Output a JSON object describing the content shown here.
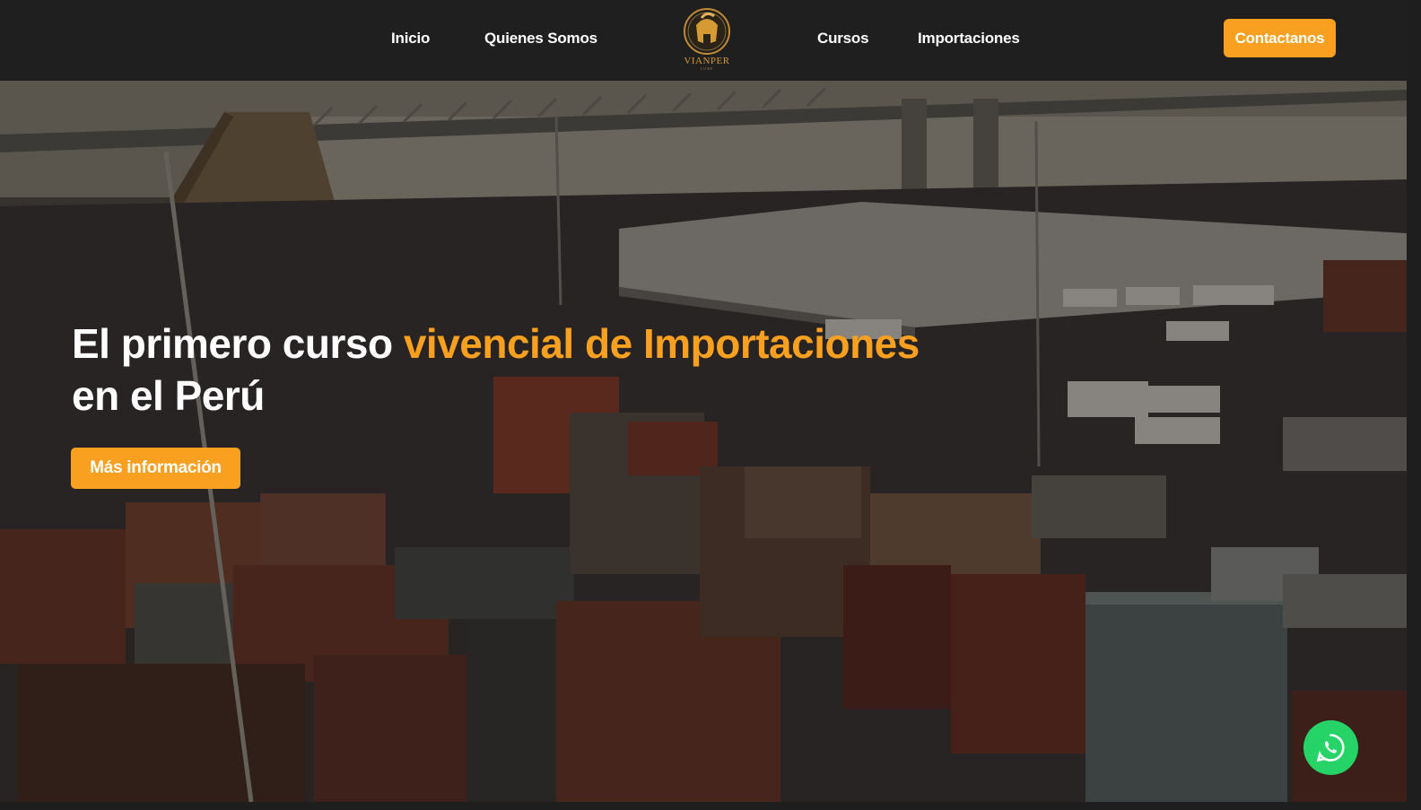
{
  "nav": {
    "links": [
      "Inicio",
      "Quienes Somos",
      "Cursos",
      "Importaciones"
    ],
    "logo": {
      "name": "VIANPER",
      "sub": "CORP",
      "icon": "spartan-helmet-icon"
    },
    "contact_label": "Contactanos"
  },
  "hero": {
    "headline_part1": "El primero curso ",
    "headline_accent": "vivencial de Importaciones",
    "headline_part2": "en el Perú",
    "cta_label": "Más información",
    "background": "port-container-terminal-photo"
  },
  "floating": {
    "icon": "whatsapp-icon"
  },
  "colors": {
    "accent": "#f9a020",
    "nav_bg": "#1f1f20",
    "whatsapp": "#25d366",
    "logo_gold": "#d69a35"
  }
}
